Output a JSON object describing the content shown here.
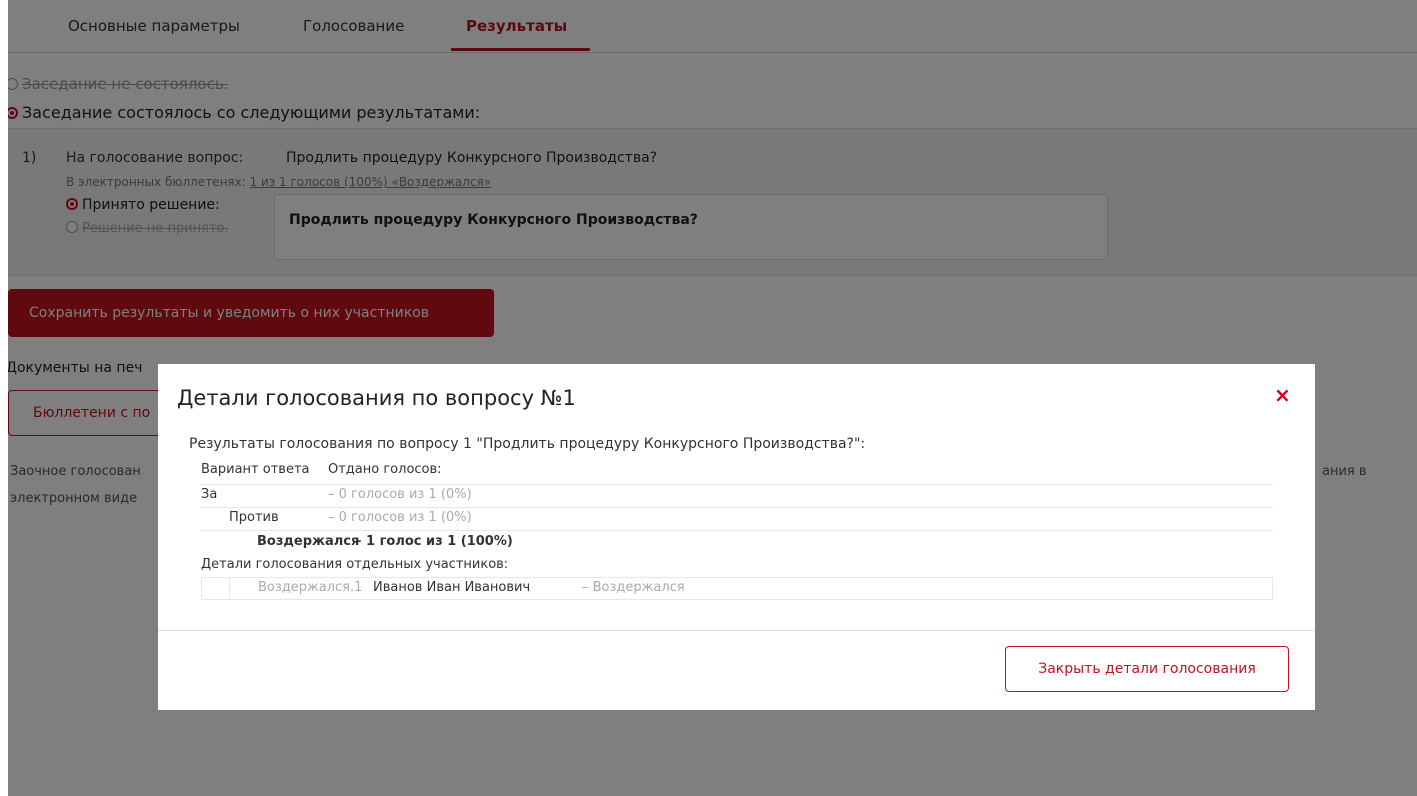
{
  "tabs": [
    {
      "label": "Основные параметры",
      "active": false
    },
    {
      "label": "Голосование",
      "active": false
    },
    {
      "label": "Результаты",
      "active": true
    }
  ],
  "meeting_options": {
    "not_held": "Заседание не состоялось.",
    "held": "Заседание состоялось со следующими результатами:"
  },
  "question": {
    "number": "1)",
    "label": "На голосование вопрос:",
    "text": "Продлить процедуру Конкурсного Производства?",
    "ebulletins_label": "В электронных бюллетенях:",
    "ebulletins_link": "1 из 1 голосов (100%) «Воздержался»",
    "decision_made": "Принято решение:",
    "decision_not_made": "Решение не принято.",
    "decision_text": "Продлить процедуру Конкурсного Производства?"
  },
  "save_button": "Сохранить результаты и уведомить о них участников",
  "documents_label": "Документы на печ",
  "ballots_button": "Бюллетени с по",
  "note": {
    "line1": "Заочное голосован",
    "line2": "электронном виде",
    "right": "ания в"
  },
  "modal": {
    "title": "Детали голосования по вопросу №1",
    "close_icon": "close-icon",
    "intro": "Результаты голосования по вопросу 1 \"Продлить процедуру Конкурсного Производства?\":",
    "col_option": "Вариант ответа",
    "col_votes": "Отдано голосов:",
    "rows": [
      {
        "option": "За",
        "votes": "– 0 голосов из 1 (0%)"
      },
      {
        "option": "Против",
        "votes": "– 0 голосов из 1 (0%)"
      },
      {
        "option": "Воздержался",
        "votes": "– 1 голос из 1 (100%)"
      }
    ],
    "details_label": "Детали голосования отдельных участников:",
    "participant": {
      "choice_ref": "Воздержался.1",
      "name": "Иванов Иван Иванович",
      "choice": "– Воздержался"
    },
    "close_button": "Закрыть детали голосования"
  },
  "colors": {
    "accent": "#c1121f",
    "radio": "#d0021b",
    "overlay": "rgba(0,0,0,0.5)"
  }
}
